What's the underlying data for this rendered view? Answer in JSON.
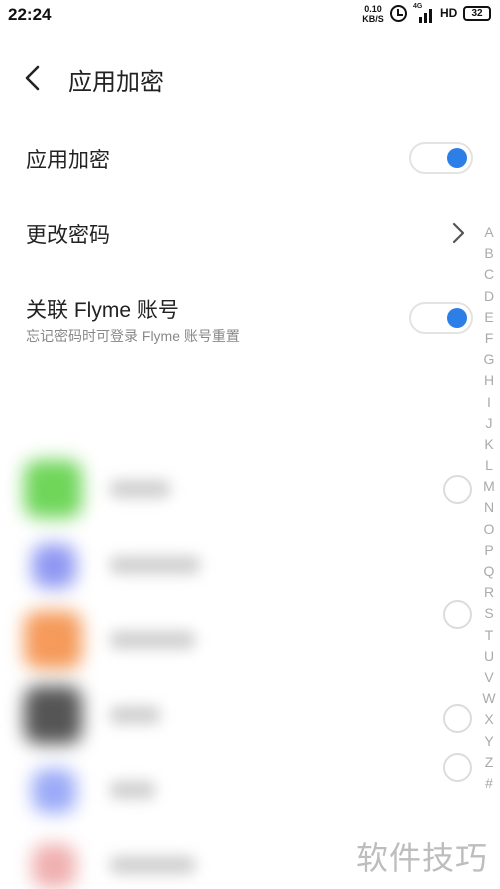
{
  "status_bar": {
    "time": "22:24",
    "net_speed_value": "0.10",
    "net_speed_unit": "KB/S",
    "network_type": "4G",
    "hd_label": "HD",
    "battery_level": "32"
  },
  "header": {
    "title": "应用加密"
  },
  "settings": {
    "app_lock": {
      "label": "应用加密",
      "enabled": true
    },
    "change_password": {
      "label": "更改密码"
    },
    "link_flyme": {
      "label": "关联 Flyme 账号",
      "sublabel": "忘记密码时可登录 Flyme 账号重置",
      "enabled": true
    }
  },
  "alphabet_index": [
    "A",
    "B",
    "C",
    "D",
    "E",
    "F",
    "G",
    "H",
    "I",
    "J",
    "K",
    "L",
    "M",
    "N",
    "O",
    "P",
    "Q",
    "R",
    "S",
    "T",
    "U",
    "V",
    "W",
    "X",
    "Y",
    "Z",
    "#"
  ],
  "app_list": {
    "icon_colors": [
      "#6fd65a",
      "#8f98f2",
      "#f59a5a",
      "#555555",
      "#9aaaf7",
      "#f0b0b0"
    ]
  },
  "colors": {
    "accent": "#2b7fe6"
  },
  "watermark": "软件技巧"
}
